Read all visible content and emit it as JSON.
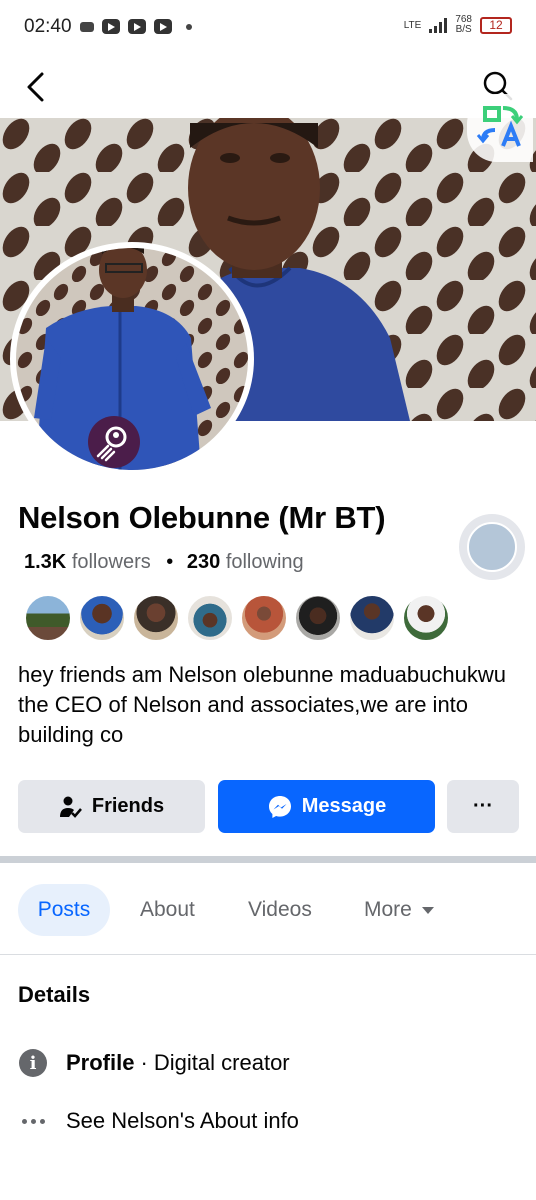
{
  "status_bar": {
    "time": "02:40",
    "network": "LTE",
    "speed_value": "768",
    "speed_unit": "B/S",
    "battery": "12"
  },
  "nav": {
    "back_icon": "chevron-left-icon",
    "search_icon": "search-icon",
    "translate_icon": "translate-icon"
  },
  "profile": {
    "name": "Nelson Olebunne (Mr BT)",
    "followers_count": "1.3K",
    "followers_label": "followers",
    "following_count": "230",
    "following_label": "following",
    "bio": "hey friends am Nelson olebunne maduabuchukwu the CEO of Nelson and associates,we are into building co"
  },
  "actions": {
    "friends_label": "Friends",
    "message_label": "Message",
    "more_label": "···"
  },
  "tabs": [
    {
      "label": "Posts",
      "active": true
    },
    {
      "label": "About",
      "active": false
    },
    {
      "label": "Videos",
      "active": false
    },
    {
      "label": "More",
      "active": false
    }
  ],
  "details": {
    "title": "Details",
    "profile_label": "Profile",
    "profile_value": "· Digital creator",
    "about_link": "See Nelson's About info"
  },
  "colors": {
    "accent": "#0866ff",
    "tab_active_bg": "#e7f0fc",
    "button_gray": "#e4e6eb",
    "text_secondary": "#65676b",
    "battery": "#b3261e"
  }
}
